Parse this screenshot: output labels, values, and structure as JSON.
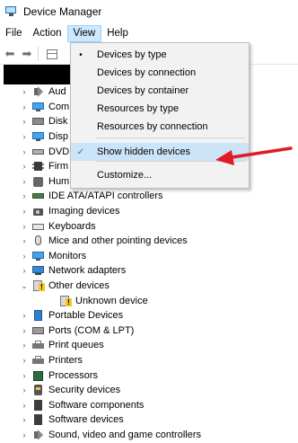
{
  "window": {
    "title": "Device Manager"
  },
  "menu": {
    "file": "File",
    "action": "Action",
    "view": "View",
    "help": "Help"
  },
  "toolbar": {
    "back": "⬅",
    "forward": "➡"
  },
  "view_menu": {
    "items": [
      {
        "label": "Devices by type",
        "mark": "•"
      },
      {
        "label": "Devices by connection",
        "mark": ""
      },
      {
        "label": "Devices by container",
        "mark": ""
      },
      {
        "label": "Resources by type",
        "mark": ""
      },
      {
        "label": "Resources by connection",
        "mark": ""
      },
      {
        "label": "Show hidden devices",
        "mark": "✓"
      },
      {
        "label": "Customize...",
        "mark": ""
      }
    ]
  },
  "tree": {
    "items": [
      {
        "label": "Aud",
        "icon": "speaker-icon",
        "chev": "›"
      },
      {
        "label": "Com",
        "icon": "monitor-icon",
        "chev": "›"
      },
      {
        "label": "Disk",
        "icon": "disk-icon",
        "chev": "›"
      },
      {
        "label": "Disp",
        "icon": "display-icon",
        "chev": "›"
      },
      {
        "label": "DVD",
        "icon": "dvd-icon",
        "chev": "›"
      },
      {
        "label": "Firm",
        "icon": "chip-icon",
        "chev": "›"
      },
      {
        "label": "Hum",
        "icon": "hid-icon",
        "chev": "›"
      },
      {
        "label": "IDE ATA/ATAPI controllers",
        "icon": "ide-icon",
        "chev": "›"
      },
      {
        "label": "Imaging devices",
        "icon": "camera-icon",
        "chev": "›"
      },
      {
        "label": "Keyboards",
        "icon": "keyboard-icon",
        "chev": "›"
      },
      {
        "label": "Mice and other pointing devices",
        "icon": "mouse-icon",
        "chev": "›"
      },
      {
        "label": "Monitors",
        "icon": "monitor-icon",
        "chev": "›"
      },
      {
        "label": "Network adapters",
        "icon": "network-icon",
        "chev": "›"
      },
      {
        "label": "Other devices",
        "icon": "warning-device-icon",
        "chev": "⌄"
      },
      {
        "label": "Unknown device",
        "icon": "warning-device-icon",
        "chev": ""
      },
      {
        "label": "Portable Devices",
        "icon": "portable-icon",
        "chev": "›"
      },
      {
        "label": "Ports (COM & LPT)",
        "icon": "port-icon",
        "chev": "›"
      },
      {
        "label": "Print queues",
        "icon": "printer-icon",
        "chev": "›"
      },
      {
        "label": "Printers",
        "icon": "printer-icon",
        "chev": "›"
      },
      {
        "label": "Processors",
        "icon": "processor-icon",
        "chev": "›"
      },
      {
        "label": "Security devices",
        "icon": "security-icon",
        "chev": "›"
      },
      {
        "label": "Software components",
        "icon": "component-icon",
        "chev": "›"
      },
      {
        "label": "Software devices",
        "icon": "component-icon",
        "chev": "›"
      },
      {
        "label": "Sound, video and game controllers",
        "icon": "sound-icon",
        "chev": "›"
      }
    ]
  },
  "colors": {
    "arrow": "#e01b24",
    "menu_highlight": "#cce4f7"
  }
}
